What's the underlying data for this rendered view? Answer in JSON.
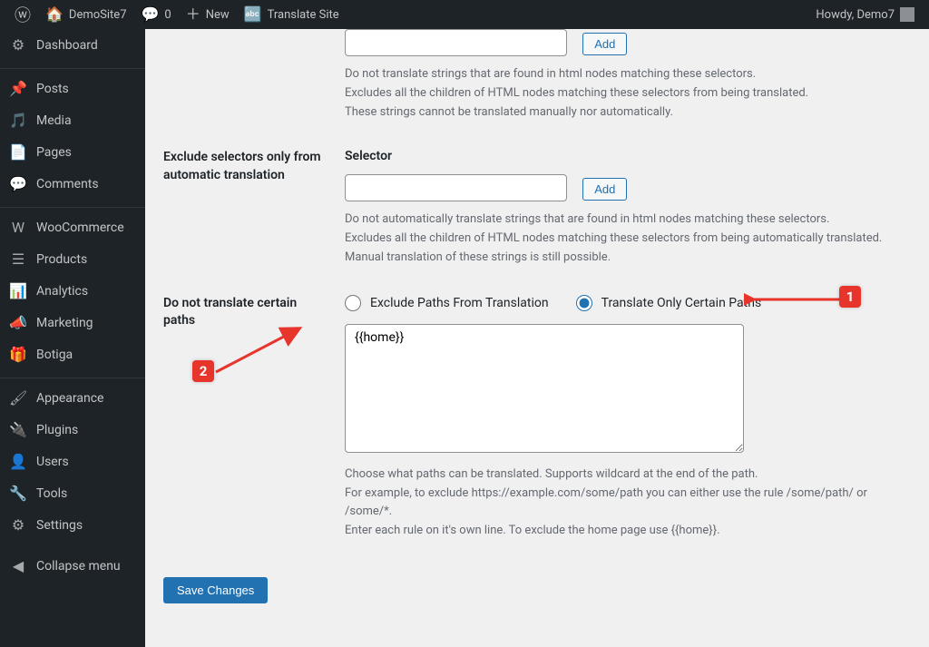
{
  "adminbar": {
    "site_name": "DemoSite7",
    "comments_count": "0",
    "new_label": "New",
    "translate_label": "Translate Site",
    "howdy": "Howdy, Demo7"
  },
  "sidebar": {
    "items": [
      {
        "icon": "⚙",
        "label": "Dashboard",
        "cls": "dashboard"
      },
      {
        "sep": true
      },
      {
        "icon": "📌",
        "label": "Posts"
      },
      {
        "icon": "🎵",
        "label": "Media"
      },
      {
        "icon": "📄",
        "label": "Pages"
      },
      {
        "icon": "💬",
        "label": "Comments"
      },
      {
        "sep": true
      },
      {
        "icon": "W",
        "label": "WooCommerce"
      },
      {
        "icon": "☰",
        "label": "Products"
      },
      {
        "icon": "📊",
        "label": "Analytics"
      },
      {
        "icon": "📣",
        "label": "Marketing"
      },
      {
        "icon": "🎁",
        "label": "Botiga"
      },
      {
        "sep": true
      },
      {
        "icon": "🖌",
        "label": "Appearance"
      },
      {
        "icon": "🔌",
        "label": "Plugins"
      },
      {
        "icon": "👤",
        "label": "Users"
      },
      {
        "icon": "🔧",
        "label": "Tools"
      },
      {
        "icon": "⚙",
        "label": "Settings"
      }
    ],
    "collapse": "Collapse menu"
  },
  "section1": {
    "add_btn": "Add",
    "desc_lines": [
      "Do not translate strings that are found in html nodes matching these selectors.",
      "Excludes all the children of HTML nodes matching these selectors from being translated.",
      "These strings cannot be translated manually nor automatically."
    ]
  },
  "section2": {
    "heading": "Exclude selectors only from automatic translation",
    "field_label": "Selector",
    "add_btn": "Add",
    "desc_lines": [
      "Do not automatically translate strings that are found in html nodes matching these selectors.",
      "Excludes all the children of HTML nodes matching these selectors from being automatically translated.",
      "Manual translation of these strings is still possible."
    ]
  },
  "section3": {
    "heading": "Do not translate certain paths",
    "radio1": "Exclude Paths From Translation",
    "radio2": "Translate Only Certain Paths",
    "textarea_value": "{{home}}",
    "desc_lines": [
      "Choose what paths can be translated. Supports wildcard at the end of the path.",
      "For example, to exclude https://example.com/some/path you can either use the rule /some/path/ or /some/*.",
      "Enter each rule on it's own line. To exclude the home page use {{home}}."
    ]
  },
  "save_btn": "Save Changes",
  "markers": {
    "m1": "1",
    "m2": "2"
  }
}
